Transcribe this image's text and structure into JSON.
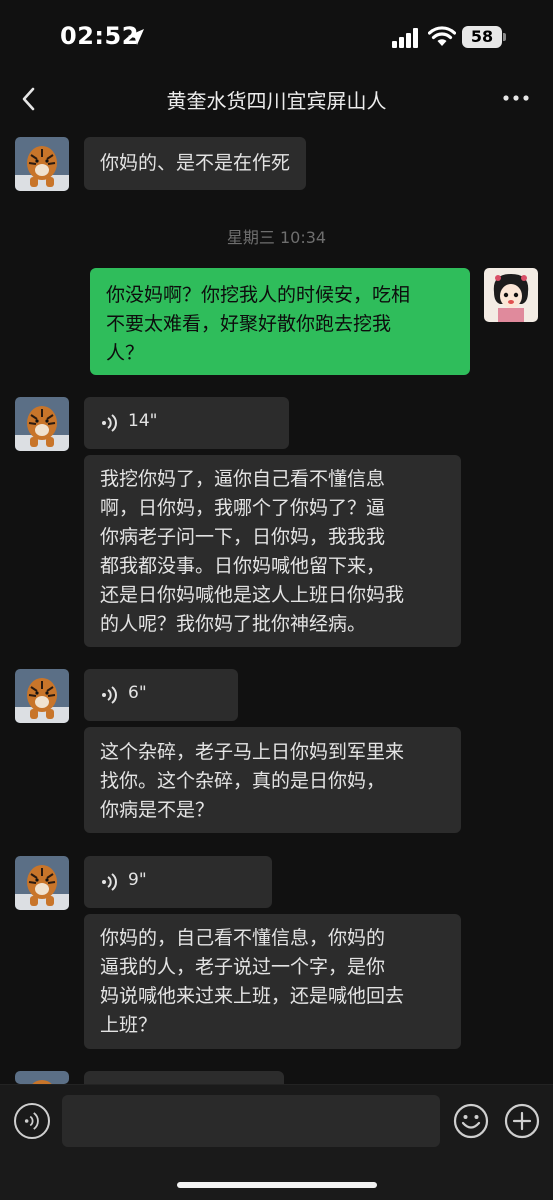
{
  "status_bar": {
    "time": "02:52",
    "battery": "58"
  },
  "header": {
    "title": "黄奎水货四川宜宾屏山人",
    "back_icon": "chevron-left-icon",
    "more_icon": "more-dots-icon"
  },
  "messages": [
    {
      "type": "text",
      "from": "other",
      "lines": [
        "你妈的、是不是在作死"
      ]
    },
    {
      "type": "time",
      "text": "星期三 10:34"
    },
    {
      "type": "text",
      "from": "me",
      "lines": [
        "你没妈啊？你挖我人的时候安，吃相",
        "不要太难看，好聚好散你跑去挖我",
        "人？"
      ]
    },
    {
      "type": "voice",
      "from": "other",
      "duration": "14\""
    },
    {
      "type": "text",
      "from": "other",
      "lines": [
        "我挖你妈了，逼你自己看不懂信息",
        "啊，日你妈，我哪个了你妈了？逼",
        "你病老子问一下，日你妈，我我我",
        "都我都没事。日你妈喊他留下来，",
        "还是日你妈喊他是这人上班日你妈我",
        "的人呢？我你妈了批你神经病。"
      ]
    },
    {
      "type": "voice",
      "from": "other",
      "duration": "6\""
    },
    {
      "type": "text",
      "from": "other",
      "lines": [
        "这个杂碎，老子马上日你妈到军里来",
        "找你。这个杂碎，真的是日你妈，",
        "你病是不是？"
      ]
    },
    {
      "type": "voice",
      "from": "other",
      "duration": "9\""
    },
    {
      "type": "text",
      "from": "other",
      "lines": [
        "你妈的，自己看不懂信息，你妈的",
        "逼我的人，老子说过一个字，是你",
        "妈说喊他来过来上班，还是喊他回去",
        "上班？"
      ]
    }
  ],
  "input_bar": {
    "placeholder": "",
    "voice_icon": "voice-toggle-icon",
    "emoji_icon": "emoji-icon",
    "plus_icon": "plus-icon"
  },
  "colors": {
    "background": "#111111",
    "bubble_in": "#2c2c2c",
    "bubble_out": "#2fbd5b"
  }
}
